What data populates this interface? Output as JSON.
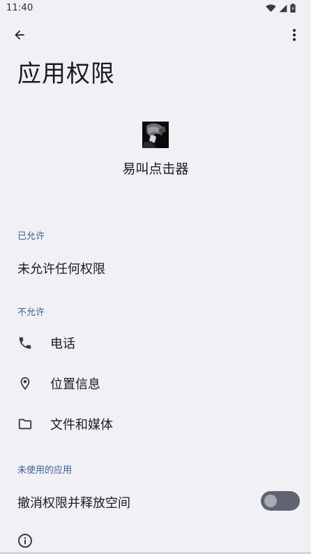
{
  "status_bar": {
    "time": "11:40",
    "icons": [
      "wifi-icon",
      "signal-icon",
      "battery-icon"
    ]
  },
  "top_bar": {
    "back_icon": "arrow-back-icon",
    "more_icon": "more-vert-icon"
  },
  "page": {
    "title": "应用权限"
  },
  "app": {
    "name": "易叫点击器",
    "icon": "app-avatar-icon"
  },
  "sections": {
    "allowed": {
      "header": "已允许",
      "empty_text": "未允许任何权限"
    },
    "denied": {
      "header": "不允许",
      "items": [
        {
          "label": "电话",
          "icon": "phone-icon"
        },
        {
          "label": "位置信息",
          "icon": "location-icon"
        },
        {
          "label": "文件和媒体",
          "icon": "folder-icon"
        }
      ]
    },
    "unused": {
      "header": "未使用的应用",
      "toggle_label": "撤消权限并释放空间",
      "toggle_checked": false
    }
  },
  "footer": {
    "info_icon": "info-icon"
  },
  "colors": {
    "background": "#f1f0f5",
    "section_header": "#3b5f92",
    "text": "#1b1b1f",
    "toggle_track": "#5f6470",
    "toggle_knob": "#a8abb3"
  }
}
